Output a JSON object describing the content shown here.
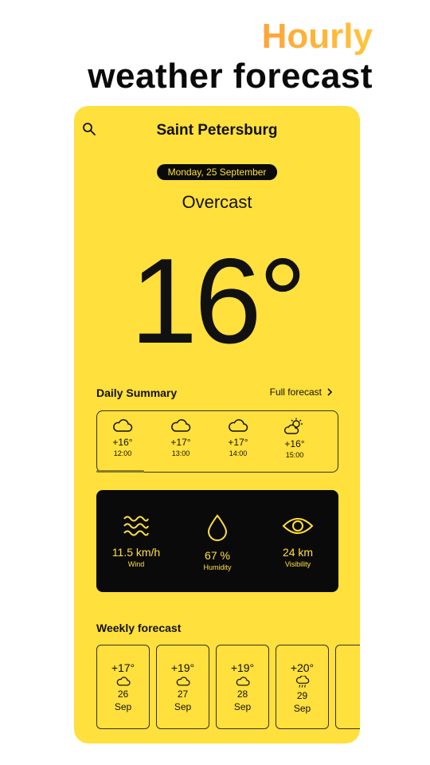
{
  "promo": {
    "line1": "Hourly",
    "line2": "weather forecast"
  },
  "header": {
    "city": "Saint Petersburg",
    "date": "Monday, 25 September",
    "search_icon": "search-icon"
  },
  "current": {
    "condition": "Overcast",
    "temperature": "16°"
  },
  "daily_summary": {
    "title": "Daily Summary",
    "link": "Full forecast",
    "hours": [
      {
        "temp": "+16°",
        "time": "12:00",
        "icon": "cloud-icon"
      },
      {
        "temp": "+17°",
        "time": "13:00",
        "icon": "cloud-icon"
      },
      {
        "temp": "+17°",
        "time": "14:00",
        "icon": "cloud-icon"
      },
      {
        "temp": "+16°",
        "time": "15:00",
        "icon": "partly-sunny-icon"
      }
    ]
  },
  "stats": {
    "wind": {
      "value": "11.5 km/h",
      "label": "Wind"
    },
    "humidity": {
      "value": "67 %",
      "label": "Humidity"
    },
    "visibility": {
      "value": "24 km",
      "label": "Visibility"
    }
  },
  "weekly": {
    "title": "Weekly forecast",
    "days": [
      {
        "temp": "+17°",
        "day": "26",
        "month": "Sep",
        "icon": "cloud-icon"
      },
      {
        "temp": "+19°",
        "day": "27",
        "month": "Sep",
        "icon": "cloud-icon"
      },
      {
        "temp": "+19°",
        "day": "28",
        "month": "Sep",
        "icon": "cloud-icon"
      },
      {
        "temp": "+20°",
        "day": "29",
        "month": "Sep",
        "icon": "rain-cloud-icon"
      }
    ]
  },
  "colors": {
    "accent": "#ffe03c",
    "dark": "#0a0a0a"
  }
}
